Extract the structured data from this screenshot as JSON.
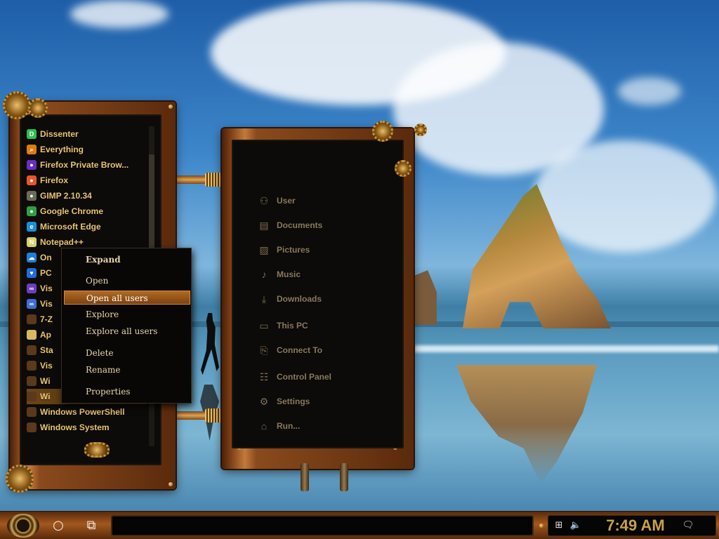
{
  "start_menu": {
    "apps": [
      {
        "label": "Dissenter",
        "icon": "dissenter-icon",
        "color": "#2fbf4a",
        "glyph": "D"
      },
      {
        "label": "Everything",
        "icon": "search-icon",
        "color": "#e07a12",
        "glyph": "⌕"
      },
      {
        "label": "Firefox Private Brow...",
        "icon": "firefox-private-icon",
        "color": "#6a2fbf",
        "glyph": "●"
      },
      {
        "label": "Firefox",
        "icon": "firefox-icon",
        "color": "#e8552a",
        "glyph": "●"
      },
      {
        "label": "GIMP 2.10.34",
        "icon": "gimp-icon",
        "color": "#6b6b5a",
        "glyph": "●"
      },
      {
        "label": "Google Chrome",
        "icon": "chrome-icon",
        "color": "#2f9e44",
        "glyph": "●"
      },
      {
        "label": "Microsoft Edge",
        "icon": "edge-icon",
        "color": "#1e8fd6",
        "glyph": "e"
      },
      {
        "label": "Notepad++",
        "icon": "notepad-icon",
        "color": "#d8d070",
        "glyph": "N"
      },
      {
        "label": "On",
        "icon": "onedrive-icon",
        "color": "#1e7fd6",
        "glyph": "☁"
      },
      {
        "label": "PC",
        "icon": "pc-health-icon",
        "color": "#1e6fd6",
        "glyph": "♥"
      },
      {
        "label": "Vis",
        "icon": "visual-studio-icon",
        "color": "#6a3fbf",
        "glyph": "∞"
      },
      {
        "label": "Vis",
        "icon": "visual-studio-code-icon",
        "color": "#3f6fd6",
        "glyph": "∞"
      },
      {
        "label": "7-Z",
        "icon": "folder-icon",
        "color": "#5a3a1a",
        "glyph": ""
      },
      {
        "label": "Ap",
        "icon": "app-folder-icon",
        "color": "#d8b860",
        "glyph": ""
      },
      {
        "label": "Sta",
        "icon": "folder-icon",
        "color": "#5a3a1a",
        "glyph": ""
      },
      {
        "label": "Vis",
        "icon": "folder-icon",
        "color": "#5a3a1a",
        "glyph": ""
      },
      {
        "label": "Wi",
        "icon": "folder-icon",
        "color": "#5a3a1a",
        "glyph": ""
      },
      {
        "label": "Wi",
        "icon": "folder-icon",
        "color": "#5a3a1a",
        "glyph": ""
      },
      {
        "label": "Windows PowerShell",
        "icon": "folder-icon",
        "color": "#5a3a1a",
        "glyph": ""
      },
      {
        "label": "Windows System",
        "icon": "folder-icon",
        "color": "#5a3a1a",
        "glyph": ""
      }
    ]
  },
  "context_menu": {
    "expand": "Expand",
    "open": "Open",
    "open_all_users": "Open all users",
    "explore": "Explore",
    "explore_all_users": "Explore all users",
    "delete": "Delete",
    "rename": "Rename",
    "properties": "Properties"
  },
  "links_panel": {
    "items": [
      {
        "label": "User",
        "icon": "user-icon",
        "glyph": "⚇"
      },
      {
        "label": "Documents",
        "icon": "documents-icon",
        "glyph": "▤"
      },
      {
        "label": "Pictures",
        "icon": "pictures-icon",
        "glyph": "▨"
      },
      {
        "label": "Music",
        "icon": "music-icon",
        "glyph": "♪"
      },
      {
        "label": "Downloads",
        "icon": "downloads-icon",
        "glyph": "⤓"
      },
      {
        "label": "This PC",
        "icon": "monitor-icon",
        "glyph": "▭"
      },
      {
        "label": "Connect To",
        "icon": "network-icon",
        "glyph": "⎘"
      },
      {
        "label": "Control Panel",
        "icon": "control-panel-icon",
        "glyph": "☷"
      },
      {
        "label": "Settings",
        "icon": "gear-icon",
        "glyph": "⚙"
      },
      {
        "label": "Run...",
        "icon": "run-icon",
        "glyph": "⌂"
      }
    ]
  },
  "taskbar": {
    "task_view_glyph": "⧉",
    "cortana_glyph": "○",
    "clock": "7:49 AM",
    "network_glyph": "⊞",
    "volume_glyph": "🔈",
    "notification_glyph": "🗨"
  },
  "colors": {
    "accent_gold": "#e8c572",
    "frame_brown": "#8a4a1c",
    "highlight": "#b26a22",
    "clock_gold": "#c8a045"
  }
}
